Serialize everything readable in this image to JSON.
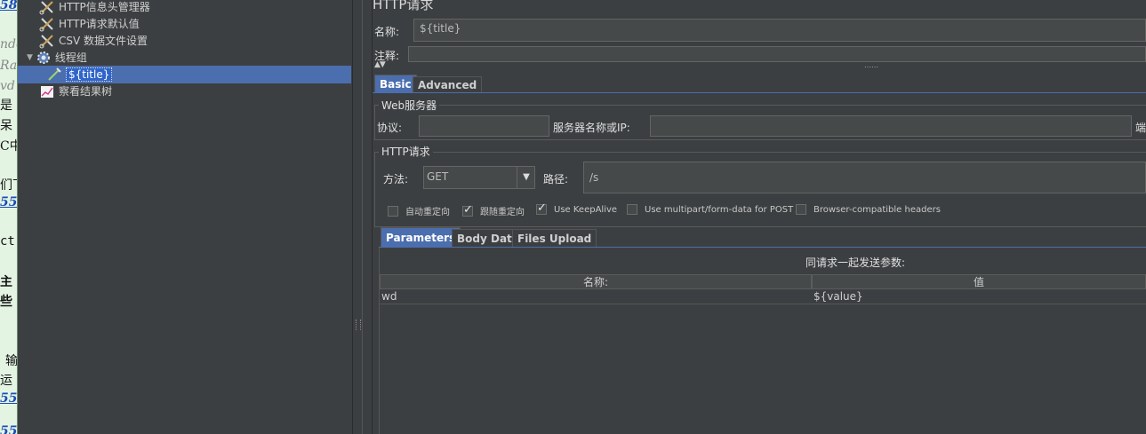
{
  "background_text": [
    "58",
    "nde",
    "Ra",
    "vd",
    "是",
    "呆",
    "C中",
    "们下",
    "55",
    "ct",
    "主",
    "些",
    "输",
    "运",
    "55",
    "55"
  ],
  "tree": {
    "items": [
      {
        "label": "HTTP信息头管理器",
        "icon": "wrench-scissors-icon"
      },
      {
        "label": "HTTP请求默认值",
        "icon": "wrench-scissors-icon"
      },
      {
        "label": "CSV 数据文件设置",
        "icon": "wrench-scissors-icon"
      },
      {
        "label": "线程组",
        "icon": "gear-icon"
      },
      {
        "label": "${title}",
        "icon": "pipette-icon"
      },
      {
        "label": "察看结果树",
        "icon": "chart-icon"
      }
    ]
  },
  "panel": {
    "title": "HTTP请求",
    "name_label": "名称:",
    "name_value": "${title}",
    "comment_label": "注释:"
  },
  "tabs": [
    "Basic",
    "Advanced"
  ],
  "web_server": {
    "title": "Web服务器",
    "protocol_label": "协议:",
    "protocol_value": "",
    "server_label": "服务器名称或IP:",
    "server_value": "",
    "port_label_partial": "端"
  },
  "http_request": {
    "title": "HTTP请求",
    "method_label": "方法:",
    "method_value": "GET",
    "path_label": "路径:",
    "path_value": "/s",
    "options": [
      {
        "label": "自动重定向",
        "checked": false
      },
      {
        "label": "跟随重定向",
        "checked": true
      },
      {
        "label": "Use KeepAlive",
        "checked": true
      },
      {
        "label": "Use multipart/form-data for POST",
        "checked": false
      },
      {
        "label": "Browser-compatible headers",
        "checked": false
      }
    ]
  },
  "sub_tabs": [
    "Parameters",
    "Body Data",
    "Files Upload"
  ],
  "params": {
    "caption": "同请求一起发送参数:",
    "columns": [
      "名称:",
      "值"
    ],
    "rows": [
      {
        "name": "wd",
        "value": "${value}"
      }
    ]
  },
  "colors": {
    "selection": "#4b6eaf",
    "background": "#3c3f41",
    "field": "#45494a"
  }
}
